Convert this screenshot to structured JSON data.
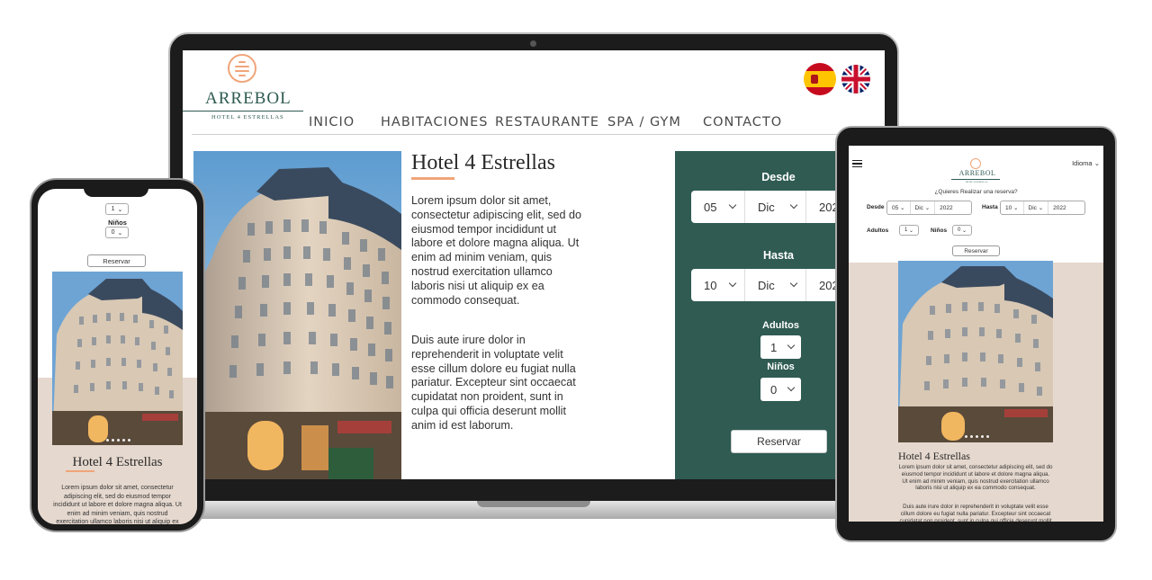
{
  "brand": {
    "name": "ARREBOL",
    "tagline": "HOTEL 4 ESTRELLAS"
  },
  "nav": [
    "INICIO",
    "HABITACIONES",
    "RESTAURANTE",
    "SPA / GYM",
    "CONTACTO"
  ],
  "languages": [
    {
      "code": "es",
      "icon": "spain-flag-icon"
    },
    {
      "code": "en",
      "icon": "uk-flag-icon"
    }
  ],
  "hero": {
    "title": "Hotel 4 Estrellas",
    "paragraphs": [
      "Lorem ipsum dolor sit amet, consectetur adipiscing elit, sed do eiusmod tempor incididunt ut labore et dolore magna aliqua. Ut enim ad minim veniam, quis nostrud exercitation ullamco laboris nisi ut aliquip ex ea commodo consequat.",
      "Duis aute irure dolor in reprehenderit in voluptate velit esse cillum dolore eu fugiat nulla pariatur. Excepteur sint occaecat cupidatat non proident, sunt in culpa qui officia deserunt mollit anim id est laborum."
    ]
  },
  "booking": {
    "from_label": "Desde",
    "from": {
      "day": "05",
      "month": "Dic",
      "year": "2022"
    },
    "to_label": "Hasta",
    "to": {
      "day": "10",
      "month": "Dic",
      "year": "2022"
    },
    "adults_label": "Adultos",
    "adults": "1",
    "children_label": "Niños",
    "children": "0",
    "reserve_label": "Reservar"
  },
  "tablet": {
    "language_label": "Idioma",
    "question": "¿Quieres Realizar una reserva?"
  },
  "colors": {
    "primary": "#2f5b52",
    "accent": "#f0a57a",
    "beige": "#e5d8ce"
  }
}
